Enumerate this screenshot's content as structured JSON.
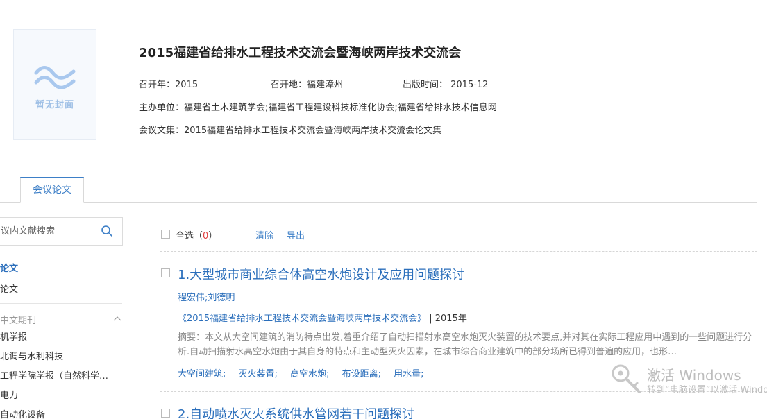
{
  "cover": {
    "text": "暂无封面"
  },
  "conference": {
    "title": "2015福建省给排水工程技术交流会暨海峡两岸技术交流会",
    "year_label": "召开年：2015",
    "place_label": "召开地：福建漳州",
    "publish_label": "出版时间： 2015-12",
    "organizer_label": "主办单位：福建省土木建筑学会;福建省工程建设科技标准化协会;福建省给排水技术信息网",
    "proceedings_label": "会议文集：2015福建省给排水工程技术交流会暨海峡两岸技术交流会论文集"
  },
  "tabs": [
    {
      "label": "会议论文"
    }
  ],
  "sidebar": {
    "search_placeholder": "议内文献搜索",
    "links": [
      {
        "label": "论文"
      },
      {
        "label": "论文"
      }
    ],
    "group_title": "中文期刊",
    "journals": [
      {
        "label": "机学报"
      },
      {
        "label": "北调与水利科技"
      },
      {
        "label": "工程学院学报（自然科学…"
      },
      {
        "label": "电力"
      },
      {
        "label": "自动化设备"
      }
    ]
  },
  "toolbar": {
    "select_all": "全选（",
    "count": "0",
    "close_paren": "）",
    "clear": "清除",
    "export": "导出"
  },
  "papers": [
    {
      "title": "1.大型城市商业综合体高空水炮设计及应用问题探讨",
      "authors": "程宏伟;刘德明",
      "source": "《2015福建省给排水工程技术交流会暨海峡两岸技术交流会》",
      "year": "| 2015年",
      "abstract": "摘要：本文从大空间建筑的消防特点出发,着重介绍了自动扫描射水高空水炮灭火装置的技术要点,并对其在实际工程应用中遇到的一些问题进行分析.自动扫描射水高空水炮由于其自身的特点和主动型灭火因素，在城市综合商业建筑中的部分场所已得到普遍的应用，也形…",
      "keywords": [
        "大空间建筑;",
        "灭火装置;",
        "高空水炮;",
        "布设距离;",
        "用水量;"
      ]
    },
    {
      "title": "2.自动喷水灭火系统供水管网若干问题探讨"
    }
  ],
  "watermark": {
    "title": "激活 Windows",
    "subtitle": "转到“电脑设置”以激活 Windows。"
  }
}
